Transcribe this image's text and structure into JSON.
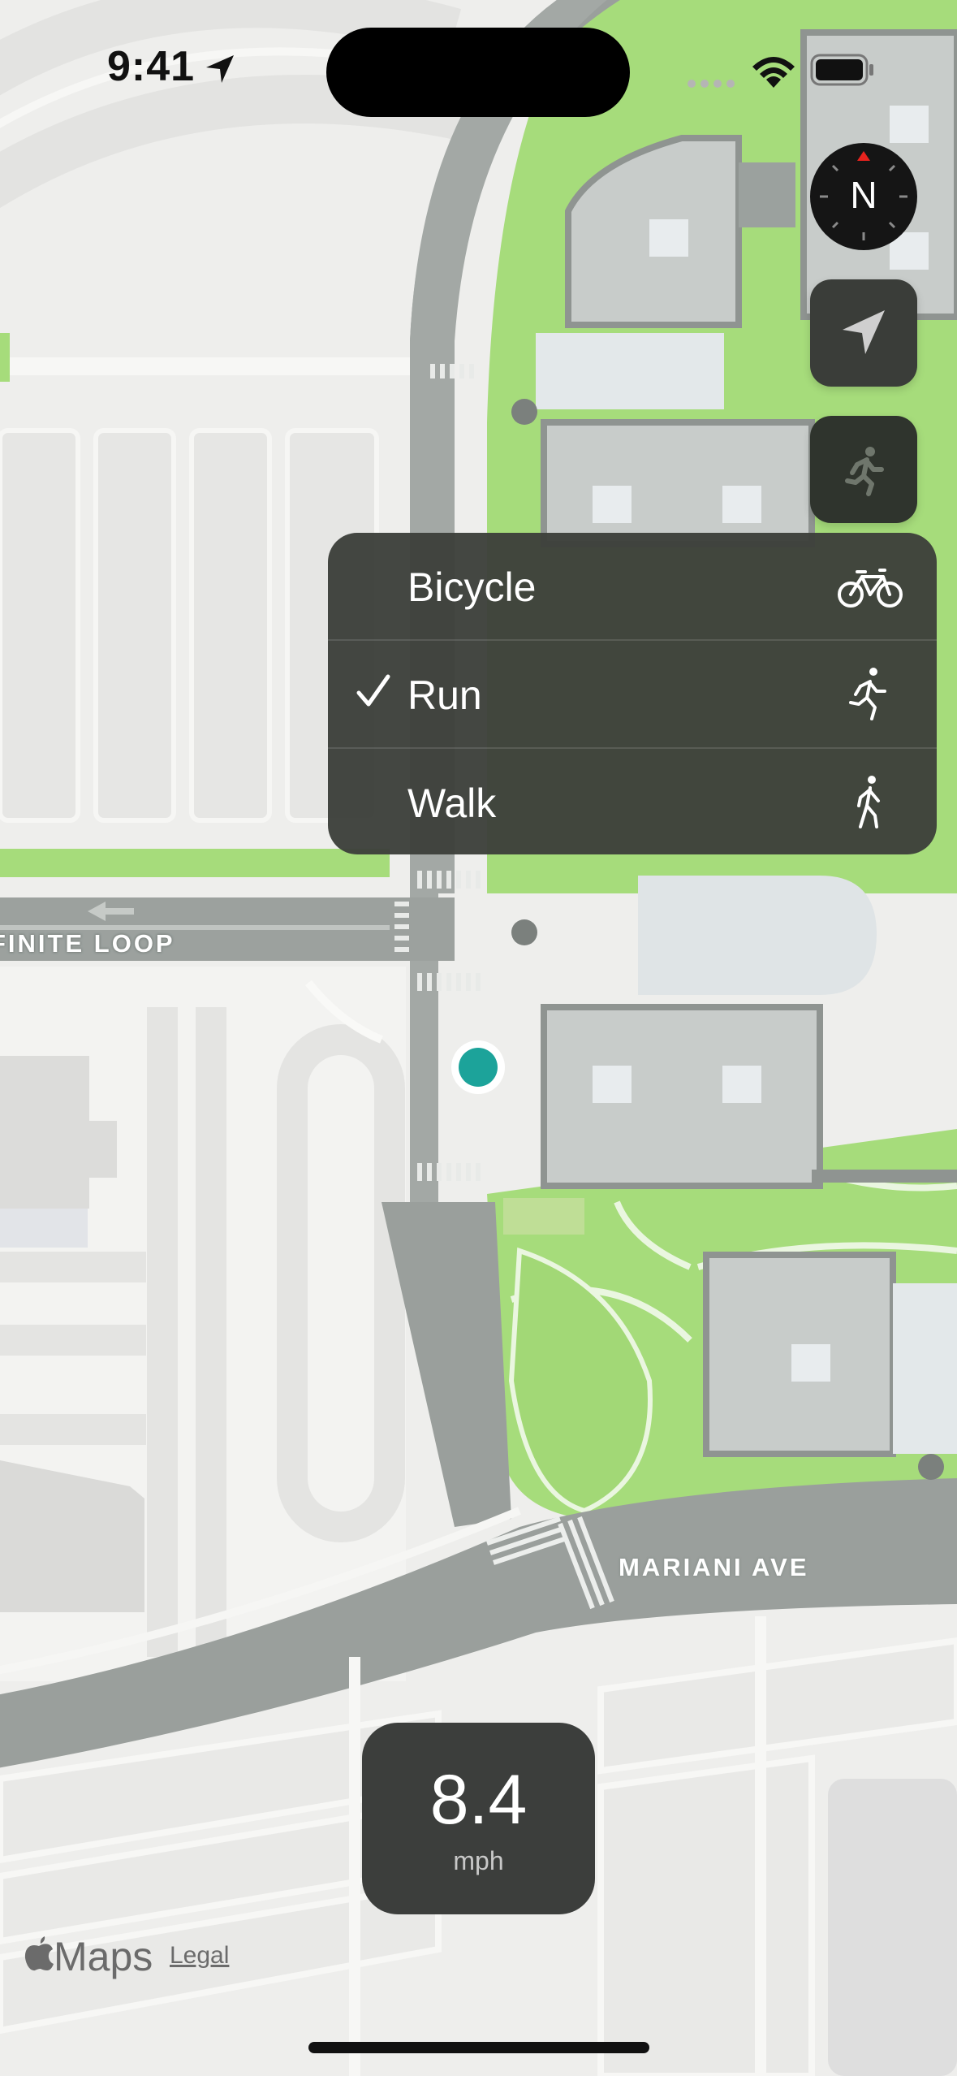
{
  "status_bar": {
    "time": "9:41",
    "icons": [
      "location-arrow-icon",
      "signal-dots-icon",
      "wifi-icon",
      "battery-icon"
    ]
  },
  "map": {
    "colors": {
      "background": "#eeeeec",
      "road": "#9a9f9c",
      "park": "#a6dc7b",
      "building": "#c8ccca",
      "user_location": "#1ca39a"
    },
    "street_labels": {
      "infinite_loop": "FINITE LOOP",
      "mariani_ave": "MARIANI AVE"
    }
  },
  "controls": {
    "compass_label": "N",
    "icons": [
      "compass-icon",
      "location-arrow-icon",
      "runner-icon"
    ]
  },
  "mode_menu": {
    "items": [
      {
        "label": "Bicycle",
        "icon": "bicycle-icon",
        "checked": false
      },
      {
        "label": "Run",
        "icon": "runner-icon",
        "checked": true
      },
      {
        "label": "Walk",
        "icon": "walker-icon",
        "checked": false
      }
    ]
  },
  "speed": {
    "value": "8.4",
    "unit": "mph"
  },
  "footer": {
    "brand": "Maps",
    "legal": "Legal"
  }
}
